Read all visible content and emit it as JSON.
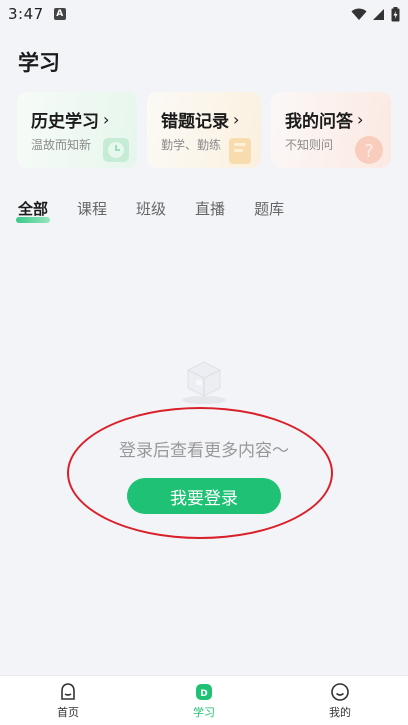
{
  "status_bar": {
    "time": "3:47",
    "notification_badge": "A"
  },
  "page": {
    "title": "学习"
  },
  "cards": [
    {
      "title": "历史学习",
      "subtitle": "温故而知新"
    },
    {
      "title": "错题记录",
      "subtitle": "勤学、勤练"
    },
    {
      "title": "我的问答",
      "subtitle": "不知则问"
    }
  ],
  "tabs": [
    {
      "label": "全部",
      "active": true
    },
    {
      "label": "课程"
    },
    {
      "label": "班级"
    },
    {
      "label": "直播"
    },
    {
      "label": "题库"
    }
  ],
  "empty_state": {
    "message": "登录后查看更多内容～",
    "login_button": "我要登录"
  },
  "bottom_nav": [
    {
      "label": "首页",
      "icon": "home-face-icon"
    },
    {
      "label": "学习",
      "icon": "study-icon",
      "active": true
    },
    {
      "label": "我的",
      "icon": "profile-face-icon"
    }
  ],
  "colors": {
    "accent": "#1fc274",
    "annotation": "#d9202a"
  }
}
